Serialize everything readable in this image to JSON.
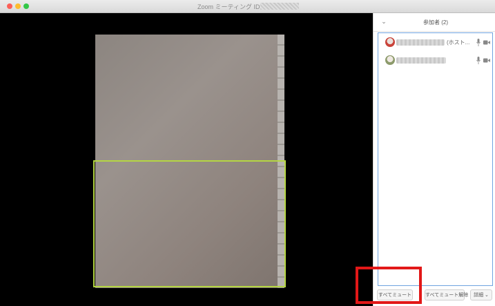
{
  "window": {
    "title": "Zoom ミーティング ID"
  },
  "participants_panel": {
    "title": "参加者 (2)",
    "participants": [
      {
        "host_tag": "(ホスト..."
      },
      {
        "host_tag": ""
      }
    ],
    "footer": {
      "mute_all_label": "すべてミュート",
      "unmute_all_label": "すべてミュート解除",
      "more_label": "詳細 ⌄"
    }
  },
  "colors": {
    "highlight": "#e21818",
    "active_speaker": "#b5d643",
    "list_border": "#6fa3e0"
  }
}
